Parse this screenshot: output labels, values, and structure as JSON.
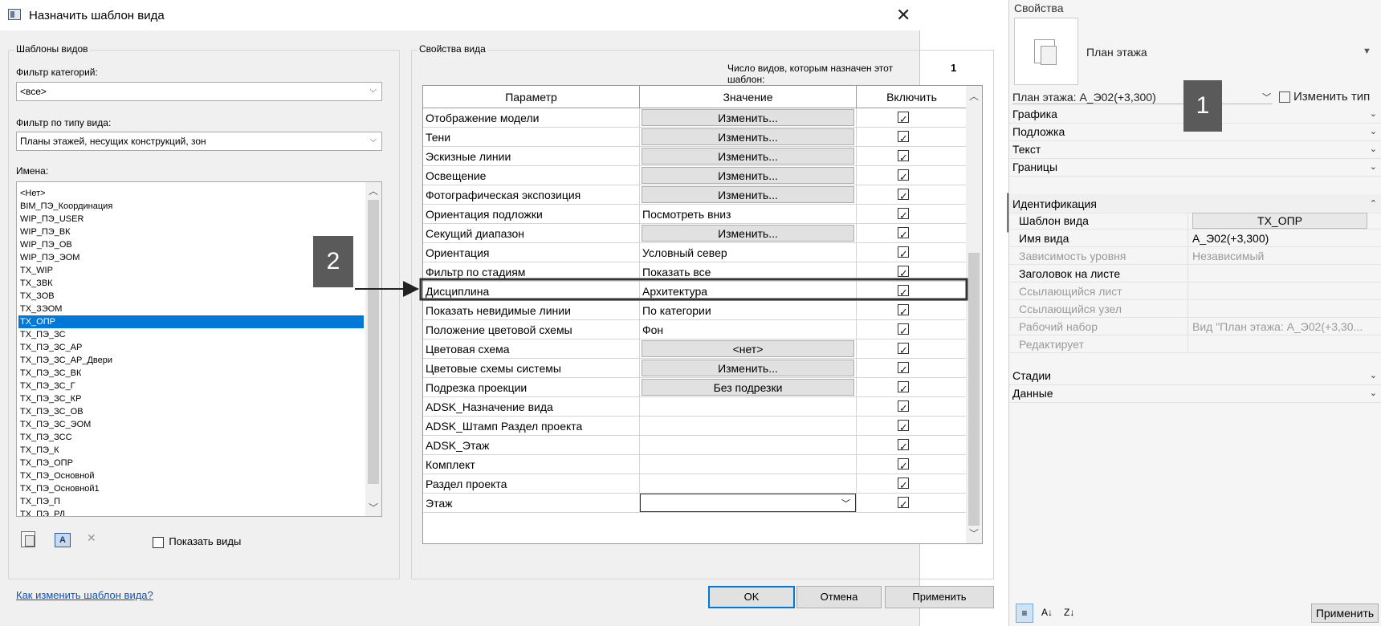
{
  "dialog": {
    "title": "Назначить шаблон вида",
    "left_group_title": "Шаблоны видов",
    "category_filter_label": "Фильтр категорий:",
    "category_filter_value": "<все>",
    "view_type_filter_label": "Фильтр по типу вида:",
    "view_type_filter_value": "Планы этажей, несущих конструкций, зон",
    "names_label": "Имена:",
    "names": [
      "<Нет>",
      "BIM_ПЭ_Координация",
      "WIP_ПЭ_USER",
      "WIP_ПЭ_ВК",
      "WIP_ПЭ_ОВ",
      "WIP_ПЭ_ЭОМ",
      "TX_WIP",
      "TX_ЗВК",
      "TX_ЗОВ",
      "TX_ЗЭОМ",
      "TX_ОПР",
      "TX_ПЭ_ЗС",
      "TX_ПЭ_ЗС_АР",
      "TX_ПЭ_ЗС_АР_Двери",
      "TX_ПЭ_ЗС_ВК",
      "TX_ПЭ_ЗС_Г",
      "TX_ПЭ_ЗС_КР",
      "TX_ПЭ_ЗС_ОВ",
      "TX_ПЭ_ЗС_ЭОМ",
      "TX_ПЭ_ЗСС",
      "TX_ПЭ_К",
      "TX_ПЭ_ОПР",
      "TX_ПЭ_Основной",
      "TX_ПЭ_Основной1",
      "TX_ПЭ_П",
      "TX_ПЭ_РД"
    ],
    "selected_name": "TX_ОПР",
    "show_views_label": "Показать виды",
    "show_views_checked": false,
    "help_link": "Как изменить шаблон вида?",
    "right_group_title": "Свойства вида",
    "views_count_label": "Число видов, которым назначен этот шаблон:",
    "views_count_value": "1",
    "columns": [
      "Параметр",
      "Значение",
      "Включить"
    ],
    "rows": [
      {
        "param": "Отображение модели",
        "value": "Изменить...",
        "button": true
      },
      {
        "param": "Тени",
        "value": "Изменить...",
        "button": true
      },
      {
        "param": "Эскизные линии",
        "value": "Изменить...",
        "button": true
      },
      {
        "param": "Освещение",
        "value": "Изменить...",
        "button": true
      },
      {
        "param": "Фотографическая экспозиция",
        "value": "Изменить...",
        "button": true
      },
      {
        "param": "Ориентация подложки",
        "value": "Посмотреть вниз",
        "button": false
      },
      {
        "param": "Секущий диапазон",
        "value": "Изменить...",
        "button": true
      },
      {
        "param": "Ориентация",
        "value": "Условный север",
        "button": false
      },
      {
        "param": "Фильтр по стадиям",
        "value": "Показать все",
        "button": false
      },
      {
        "param": "Дисциплина",
        "value": "Архитектура",
        "button": false
      },
      {
        "param": "Показать невидимые линии",
        "value": "По категории",
        "button": false
      },
      {
        "param": "Положение цветовой схемы",
        "value": "Фон",
        "button": false
      },
      {
        "param": "Цветовая схема",
        "value": "<нет>",
        "button": true
      },
      {
        "param": "Цветовые схемы системы",
        "value": "Изменить...",
        "button": true
      },
      {
        "param": "Подрезка проекции",
        "value": "Без подрезки",
        "button": true
      },
      {
        "param": "ADSK_Назначение вида",
        "value": "",
        "button": false
      },
      {
        "param": "ADSK_Штамп Раздел проекта",
        "value": "",
        "button": false
      },
      {
        "param": "ADSK_Этаж",
        "value": "",
        "button": false
      },
      {
        "param": "Комплект",
        "value": "",
        "button": false
      },
      {
        "param": "Раздел проекта",
        "value": "",
        "button": false
      },
      {
        "param": "Этаж",
        "value": "",
        "button": false,
        "dropdown": true
      }
    ],
    "ok_label": "OK",
    "cancel_label": "Отмена",
    "apply_label": "Применить"
  },
  "callouts": {
    "one": "1",
    "two": "2"
  },
  "properties": {
    "title": "Свойства",
    "type_name": "План этажа",
    "instance_selector": "План этажа: А_Э02(+3,300)",
    "edit_type_label": "Изменить тип",
    "categories_top": [
      "Графика",
      "Подложка",
      "Текст",
      "Границы"
    ],
    "identification_label": "Идентификация",
    "rows": [
      {
        "name": "Шаблон вида",
        "value": "TX_ОПР",
        "gray": false,
        "button": true
      },
      {
        "name": "Имя вида",
        "value": "А_Э02(+3,300)",
        "gray": false
      },
      {
        "name": "Зависимость уровня",
        "value": "Независимый",
        "gray": true
      },
      {
        "name": "Заголовок на листе",
        "value": "",
        "gray": false
      },
      {
        "name": "Ссылающийся лист",
        "value": "",
        "gray": true
      },
      {
        "name": "Ссылающийся узел",
        "value": "",
        "gray": true
      },
      {
        "name": "Рабочий набор",
        "value": "Вид \"План этажа: А_Э02(+3,30...",
        "gray": true
      },
      {
        "name": "Редактирует",
        "value": "",
        "gray": true
      }
    ],
    "categories_bottom": [
      "Стадии",
      "Данные"
    ],
    "apply_label": "Применить"
  }
}
